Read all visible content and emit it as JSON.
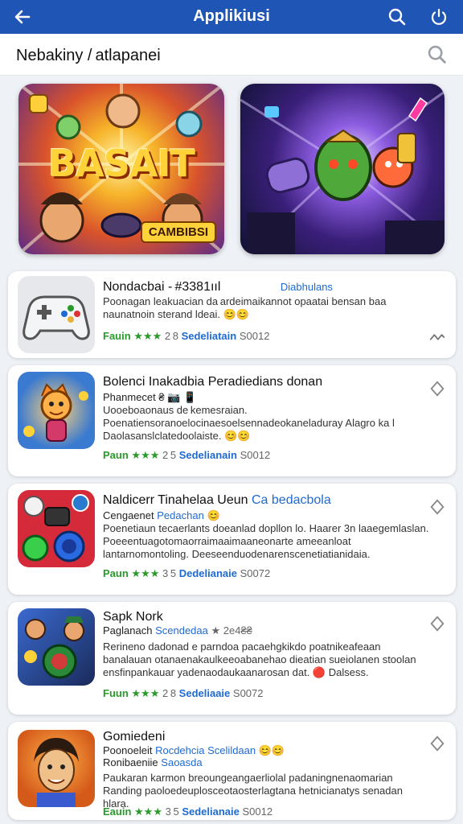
{
  "appbar": {
    "title": "Applikiusi"
  },
  "subheader": {
    "heading": "Nebakiny / atlapanei"
  },
  "banners": [
    {
      "logo": "BASAIT",
      "badge": "CAMBIBSI"
    },
    {
      "logo": ""
    }
  ],
  "cards": [
    {
      "name": "Nondacbai - #3381ııl",
      "tag": "Diabhulans",
      "desc": "Poonagan leakuacian da ardeimaikannot opaatai bensan baa naunatnoin sterand ldeai. 😊😊",
      "rating_label": "Fauin",
      "score": "2 8",
      "category": "Sedeliatain",
      "code": "S0012"
    },
    {
      "name": "Bolenci Inakadbia Peradiedians donan",
      "meta": "Phanmecet ₴ 📷 📱",
      "desc": "Uooeboaonaus de kemesraian. Poenatiensoranoelocinaesoelsennadeokaneladuray Alagro ka l Daolasanslclatedoolaiste. 😊😊",
      "rating_label": "Paun",
      "score": "2 5",
      "category": "Sedelianain",
      "code": "S0012"
    },
    {
      "name": "Naldicerr Tinahelaa Ueun",
      "name_blue": "Ca bedacbola",
      "meta": "Cengaenet",
      "meta_blue": "Pedachan",
      "desc": "Poenetiaun tecaerlants doeanlad dopllon lo. Haarer 3n laaegemlaslan. Poeeentuagotomaorraimaaimaaneonarte ameeanloat lantarnomontoling. Deeseenduodenarenscenetiatianidaia.",
      "rating_label": "Paun",
      "score": "3 5",
      "category": "Dedelianaie",
      "code": "S0072"
    },
    {
      "name": "Sapk Nork",
      "meta": "Paglanach",
      "meta_blue": "Scendedaa",
      "meta_tail": "★ 2e4₴₴",
      "desc": "Rerineno dadonad e parndoa pacaehgkikdo poatnikeafeaan banalauan otanaenakaulkeeoabanehao dieatian sueiolanen stoolan ensfinpankauar yadenaodaukaanarosan dat. 🔴 Dalsess.",
      "rating_label": "Fuun",
      "score": "2 8",
      "category": "Sedeliaaie",
      "code": "S0072"
    },
    {
      "name": "Gomiedeni",
      "meta": "Poonoeleit",
      "meta_blue": "Rocdehcia",
      "meta_tail": "Scelildaan 😊😊",
      "meta2": "Ronibaeniie",
      "meta2_blue": "Saoasda",
      "desc": "Paukaran karmon breoungeangaerliolal padaningnenaomarian Randing paoloedeuplosceotaosterlagtana hetnicianatys senadan hlara.",
      "rating_label": "Eauin",
      "score": "3 5",
      "category": "Sedelianaie",
      "code": "S0012"
    }
  ]
}
